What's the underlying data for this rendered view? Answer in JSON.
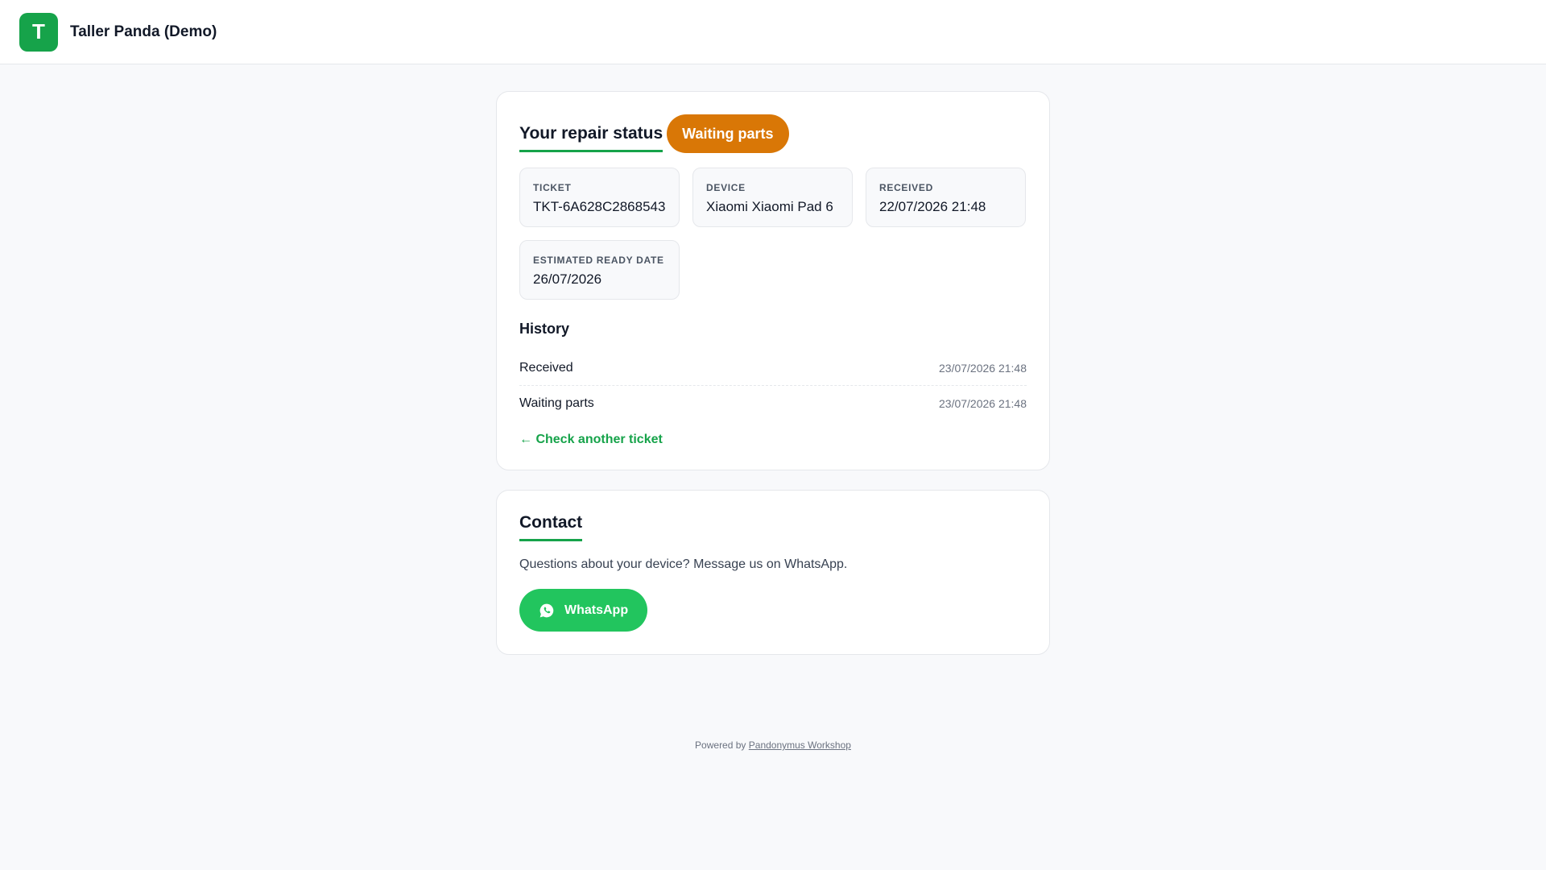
{
  "header": {
    "logo_letter": "T",
    "shop_name": "Taller Panda (Demo)"
  },
  "status_card": {
    "title": "Your repair status",
    "status_badge": "Waiting parts",
    "colors": {
      "accent": "#16a34a",
      "badge": "#d97706"
    },
    "fields": [
      {
        "label": "TICKET",
        "value": "TKT-6A628C2868543"
      },
      {
        "label": "DEVICE",
        "value": "Xiaomi Xiaomi Pad 6"
      },
      {
        "label": "RECEIVED",
        "value": "22/07/2026 21:48"
      },
      {
        "label": "ESTIMATED READY DATE",
        "value": "26/07/2026"
      }
    ],
    "history_title": "History",
    "history": [
      {
        "status": "Received",
        "time": "23/07/2026 21:48"
      },
      {
        "status": "Waiting parts",
        "time": "23/07/2026 21:48"
      }
    ],
    "back_link": "← Check another ticket"
  },
  "contact_card": {
    "title": "Contact",
    "text": "Questions about your device? Message us on WhatsApp.",
    "whatsapp_label": "WhatsApp",
    "whatsapp_color": "#22c55e",
    "icon": "whatsapp-icon"
  },
  "footer": {
    "prefix": "Powered by",
    "link_text": "Pandonymus Workshop"
  }
}
